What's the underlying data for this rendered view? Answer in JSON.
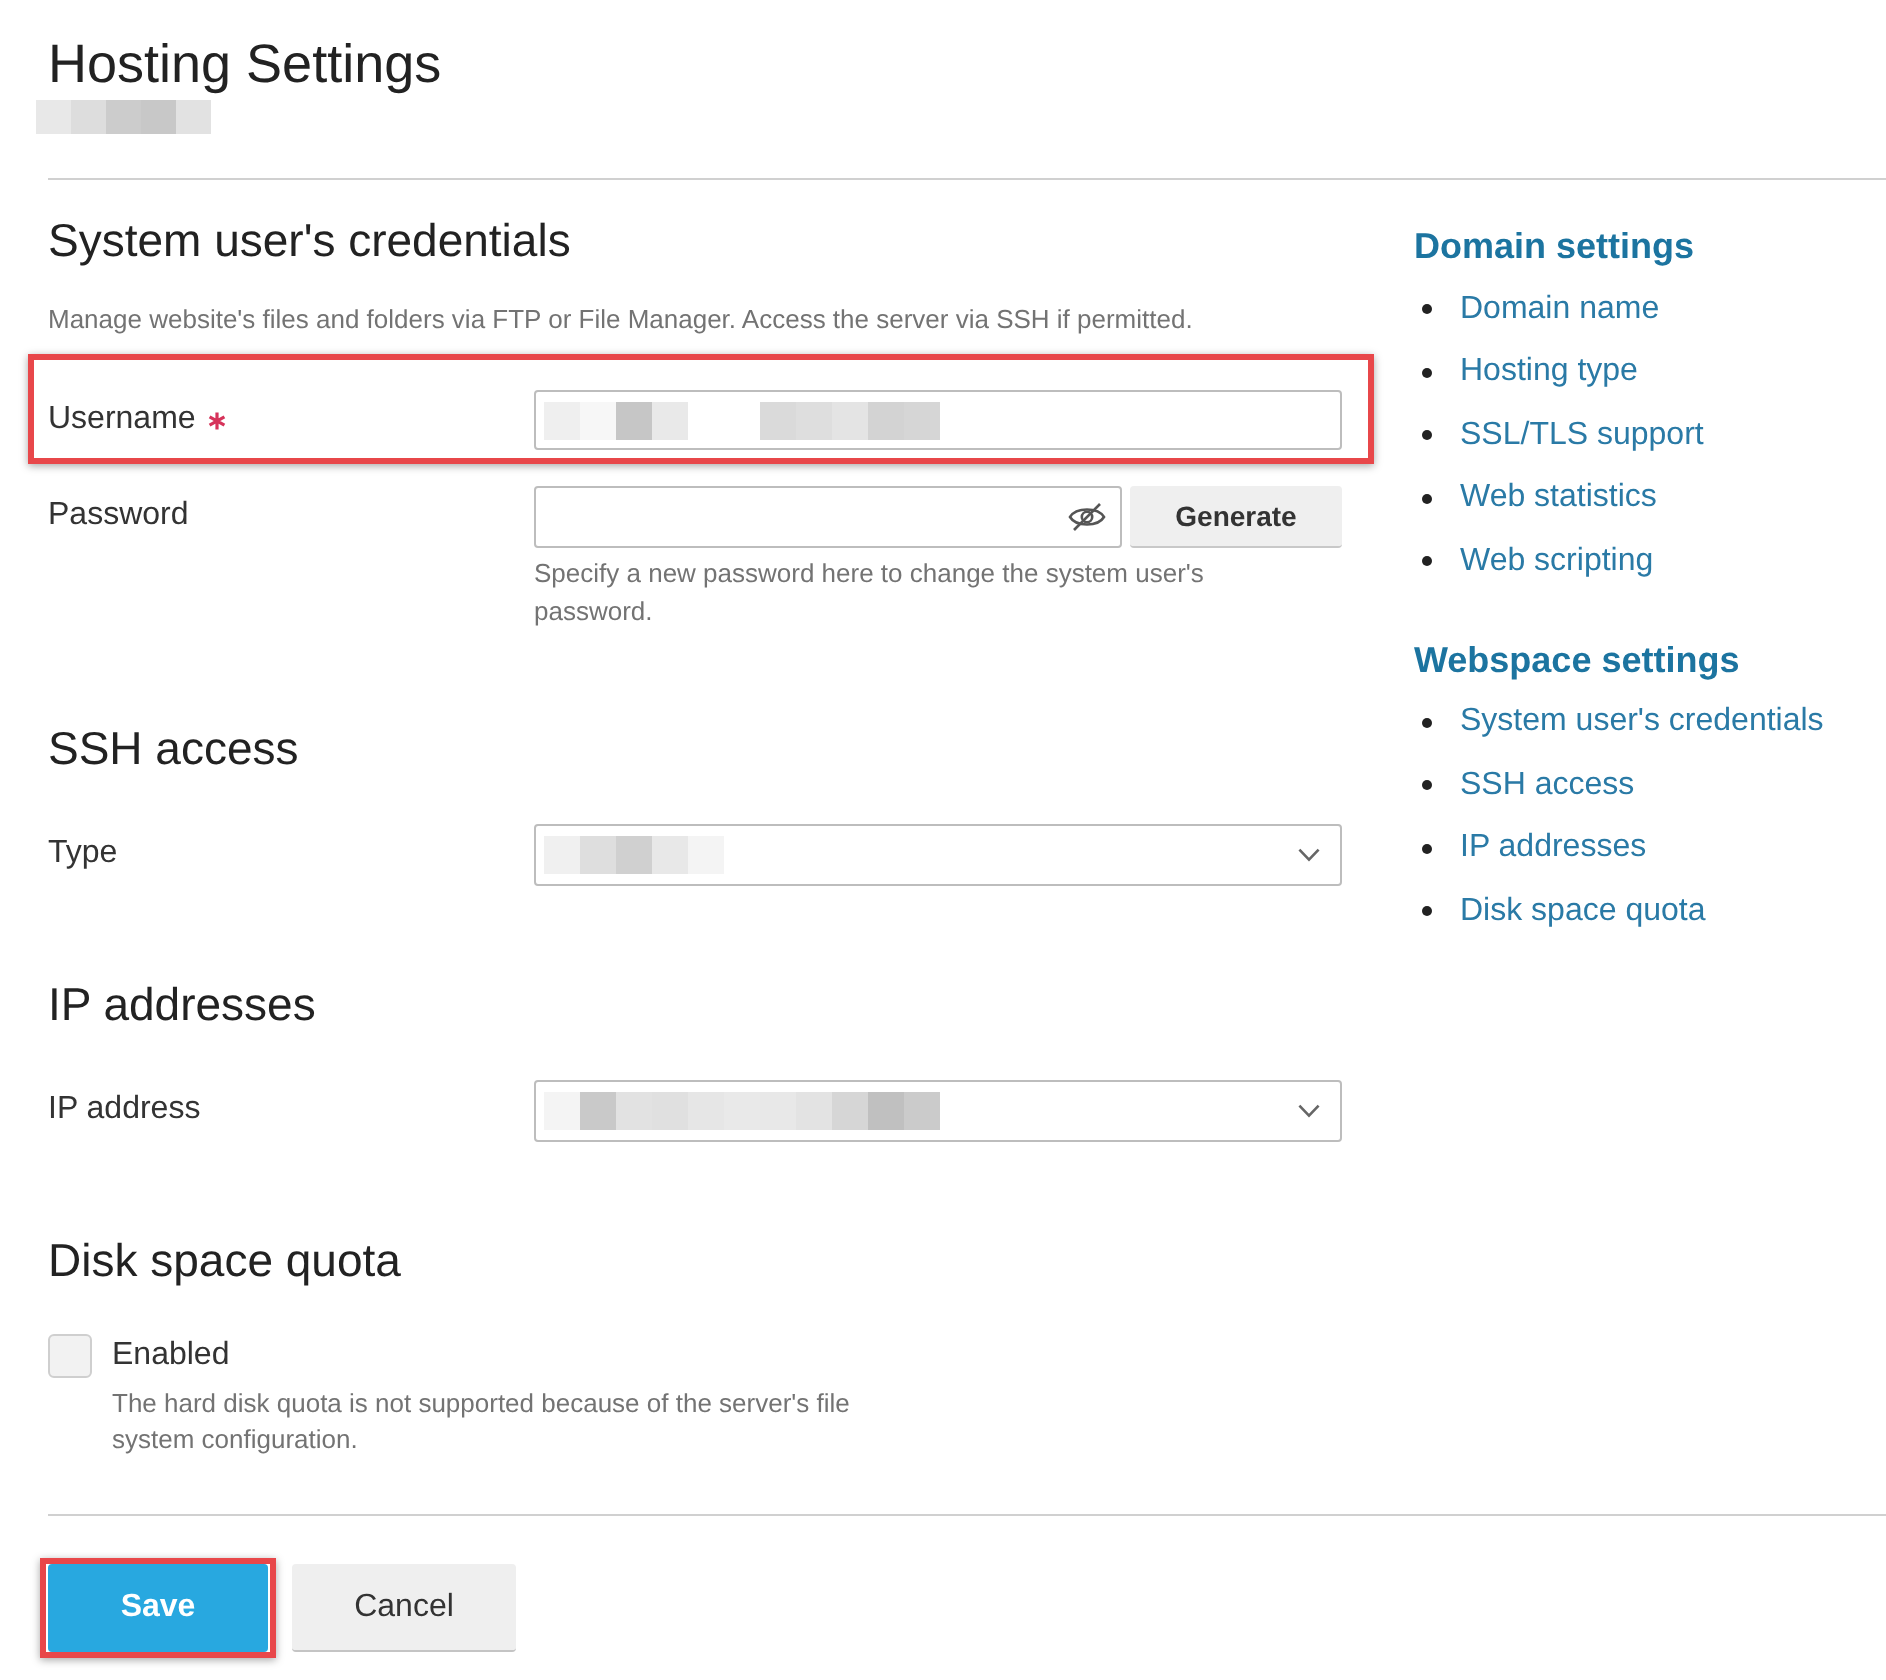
{
  "page": {
    "title": "Hosting Settings",
    "subtitle_obscured": true
  },
  "sections": [
    {
      "heading": "System user's credentials",
      "description": "Manage website's files and folders via FTP or File Manager. Access the server via SSH if permitted.",
      "fields": [
        {
          "kind": "text",
          "label": "Username",
          "required": true,
          "highlighted": true,
          "obscured": true
        },
        {
          "kind": "password",
          "label": "Password",
          "required": false,
          "highlighted": false,
          "obscured": false,
          "button": "Generate",
          "hint": "Specify a new password here to change the system user's password."
        }
      ]
    },
    {
      "heading": "SSH access",
      "fields": [
        {
          "kind": "select",
          "label": "Type",
          "required": false,
          "highlighted": false,
          "obscured": true
        }
      ]
    },
    {
      "heading": "IP addresses",
      "fields": [
        {
          "kind": "select",
          "label": "IP address",
          "required": false,
          "highlighted": false,
          "obscured": true
        }
      ]
    },
    {
      "heading": "Disk space quota",
      "fields": [
        {
          "kind": "checkbox",
          "label": "Enabled",
          "checked": false,
          "hint": "The hard disk quota is not supported because of the server's file system configuration."
        }
      ]
    }
  ],
  "buttons": [
    {
      "kind": "primary",
      "label": "Save",
      "highlighted": true
    },
    {
      "kind": "secondary",
      "label": "Cancel",
      "highlighted": false
    }
  ],
  "sidebar": {
    "groups": [
      {
        "heading": "Domain settings",
        "items": [
          "Domain name",
          "Hosting type",
          "SSL/TLS support",
          "Web statistics",
          "Web scripting"
        ]
      },
      {
        "heading": "Webspace settings",
        "items": [
          "System user's credentials",
          "SSH access",
          "IP addresses",
          "Disk space quota"
        ]
      }
    ]
  }
}
